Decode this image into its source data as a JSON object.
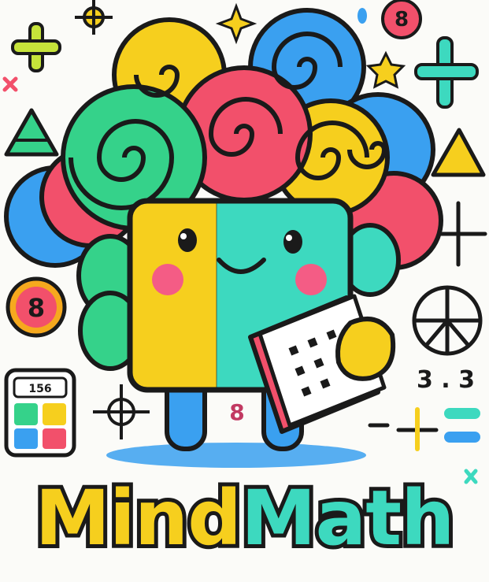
{
  "logo": {
    "title_part1": "Mind",
    "title_part2": "Math"
  },
  "badges": {
    "top_right": "8",
    "left": "8",
    "center_bottom": "8",
    "calculator_display": "156",
    "right_numbers": "3 . 3"
  },
  "colors": {
    "yellow": "#f6cf1e",
    "teal": "#3dd9bf",
    "pink": "#f2506b",
    "blue": "#3aa0f0",
    "green": "#35d28a",
    "outline": "#1a1a1a",
    "cheek": "#f45c85"
  }
}
